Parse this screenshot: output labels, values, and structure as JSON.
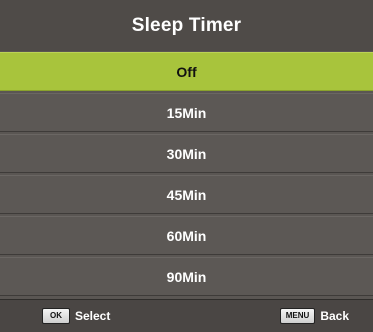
{
  "dialog": {
    "title": "Sleep Timer"
  },
  "options": [
    {
      "label": "Off",
      "selected": true
    },
    {
      "label": "15Min",
      "selected": false
    },
    {
      "label": "30Min",
      "selected": false
    },
    {
      "label": "45Min",
      "selected": false
    },
    {
      "label": "60Min",
      "selected": false
    },
    {
      "label": "90Min",
      "selected": false
    }
  ],
  "footer": {
    "select_key": "OK",
    "select_label": "Select",
    "back_key": "MENU",
    "back_label": "Back"
  },
  "colors": {
    "panel_background": "#5a5653",
    "selected_highlight": "#a8c43c",
    "text": "#ffffff"
  }
}
